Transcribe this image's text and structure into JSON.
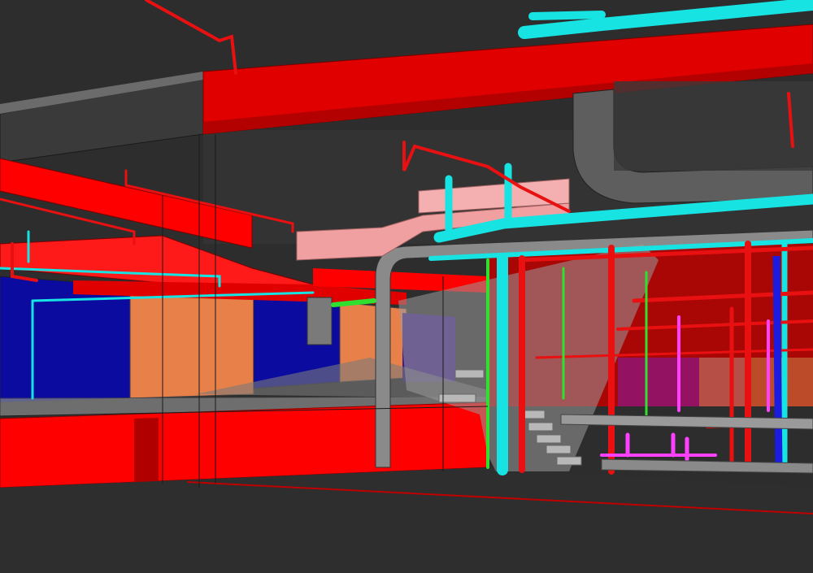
{
  "scene": {
    "kind": "3D BIM model render - building services (MEP) coordination view",
    "colors": {
      "background": "#2d2d2d",
      "structure_red": "#ff0000",
      "structure_dark_red": "#c40000",
      "pipe_cyan": "#17e3e3",
      "pipe_red": "#e81010",
      "pipe_green": "#2fe02f",
      "pipe_magenta": "#ff40ff",
      "pipe_blue": "#1c1ce0",
      "wall_blue": "#0b0ba0",
      "wall_orange": "#e8804a",
      "duct_pink": "#f0a0a0",
      "duct_grey": "#5e5e5e",
      "stair_grey": "#9a9a9a"
    }
  }
}
